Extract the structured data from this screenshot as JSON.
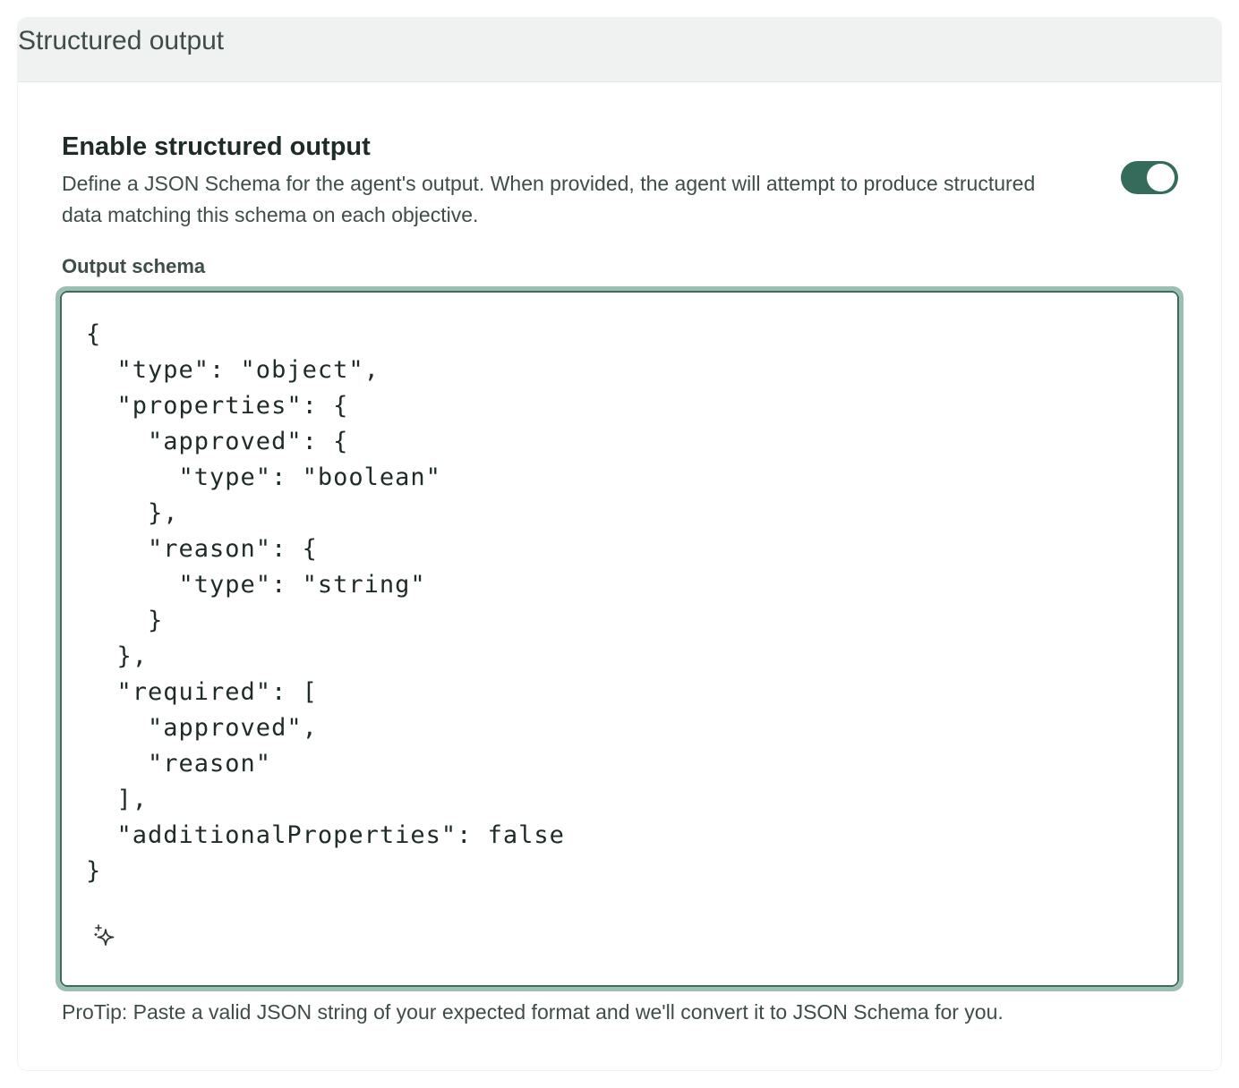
{
  "panel": {
    "title": "Structured output"
  },
  "setting": {
    "title": "Enable structured output",
    "description": "Define a JSON Schema for the agent's output. When provided, the agent will attempt to produce structured data matching this schema on each objective.",
    "enabled": true
  },
  "schema_field": {
    "label": "Output schema",
    "value": "{\n  \"type\": \"object\",\n  \"properties\": {\n    \"approved\": {\n      \"type\": \"boolean\"\n    },\n    \"reason\": {\n      \"type\": \"string\"\n    }\n  },\n  \"required\": [\n    \"approved\",\n    \"reason\"\n  ],\n  \"additionalProperties\": false\n}",
    "assist_icon": "sparkle-icon",
    "protip": "ProTip: Paste a valid JSON string of your expected format and we'll convert it to JSON Schema for you."
  },
  "colors": {
    "toggle_on": "#356b5b",
    "focus_ring": "#9cbfb3",
    "editor_border": "#3d6b5d",
    "header_bg": "#eff2f1"
  }
}
